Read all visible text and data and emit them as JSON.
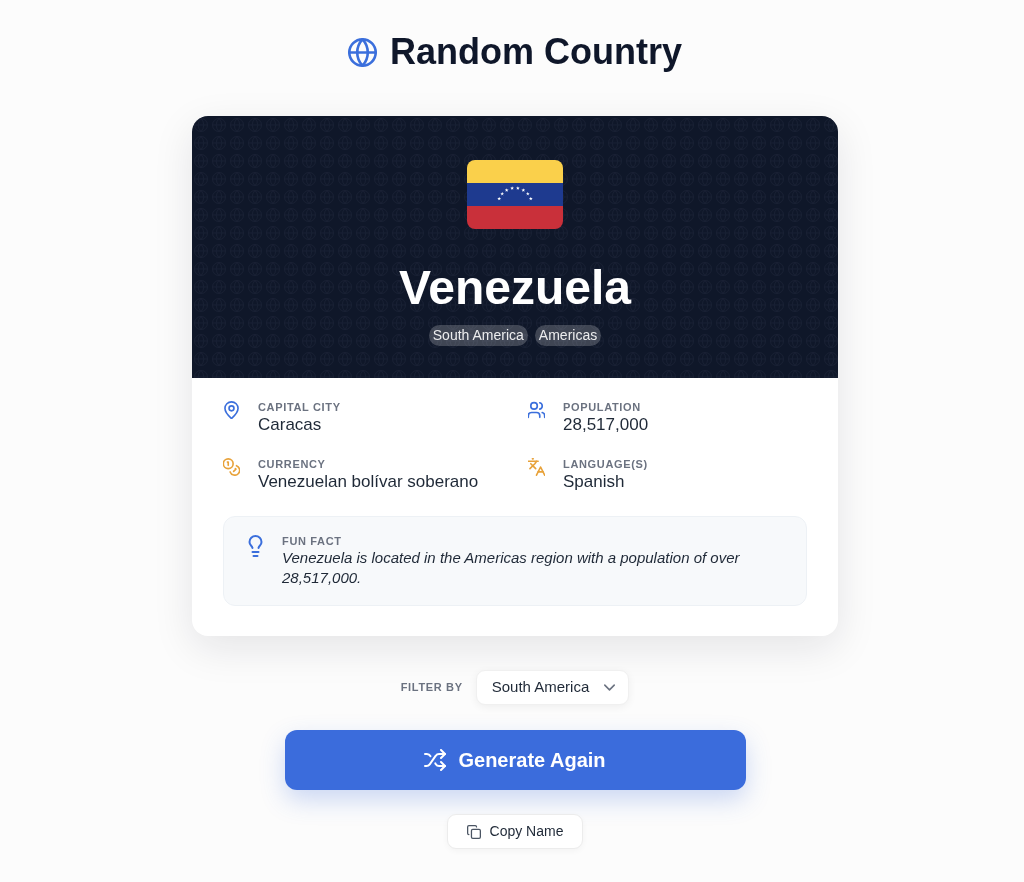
{
  "header": {
    "title": "Random Country"
  },
  "country": {
    "name": "Venezuela",
    "tags": [
      "South America",
      "Americas"
    ]
  },
  "facts": [
    {
      "kind": "capital",
      "label": "CAPITAL CITY",
      "value": "Caracas"
    },
    {
      "kind": "population",
      "label": "POPULATION",
      "value": "28,517,000"
    },
    {
      "kind": "currency",
      "label": "CURRENCY",
      "value": "Venezuelan bolívar soberano"
    },
    {
      "kind": "language",
      "label": "LANGUAGE(S)",
      "value": "Spanish"
    }
  ],
  "fun_fact": {
    "label": "FUN FACT",
    "text": "Venezuela is located in the Americas region with a population of over 28,517,000."
  },
  "filter": {
    "label": "FILTER BY",
    "value": "South America"
  },
  "generate_button": {
    "label": "Generate Again"
  },
  "copy_button": {
    "label": "Copy Name"
  }
}
